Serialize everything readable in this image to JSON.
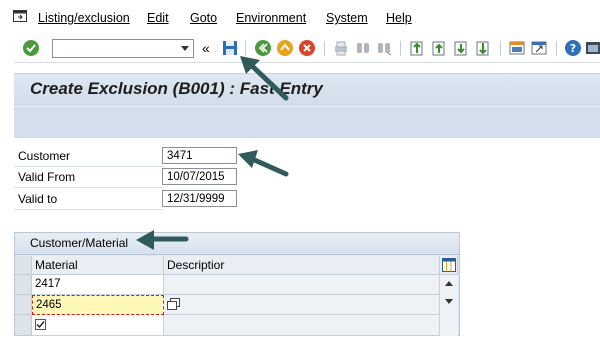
{
  "menubar": {
    "items": [
      {
        "label": "Listing/exclusion"
      },
      {
        "label": "Edit"
      },
      {
        "label": "Goto"
      },
      {
        "label": "Environment"
      },
      {
        "label": "System"
      },
      {
        "label": "Help"
      }
    ]
  },
  "toolbar": {
    "command_value": "",
    "icons": [
      "enter-checkmark-icon",
      "save-icon",
      "back-icon",
      "exit-icon",
      "cancel-icon",
      "print-icon",
      "find-icon",
      "find-next-icon",
      "first-page-icon",
      "previous-page-icon",
      "next-page-icon",
      "last-page-icon",
      "create-session-icon",
      "shortcut-icon",
      "help-icon",
      "customize-layout-icon"
    ]
  },
  "page": {
    "title": "Create Exclusion (B001) : Fast Entry"
  },
  "form": {
    "customer_label": "Customer",
    "customer_value": "3471",
    "valid_from_label": "Valid From",
    "valid_from_value": "10/07/2015",
    "valid_to_label": "Valid to",
    "valid_to_value": "12/31/9999"
  },
  "table": {
    "title": "Customer/Material",
    "columns": [
      "Material",
      "Descriptior"
    ],
    "rows": [
      {
        "material": "2417",
        "description": ""
      },
      {
        "material": "2465",
        "description": ""
      },
      {
        "material": "",
        "description": ""
      }
    ]
  },
  "colors": {
    "accent_arrow": "#2f5b5a",
    "title_bg": "#d3dfec",
    "edit_cell": "#fff8b8"
  }
}
